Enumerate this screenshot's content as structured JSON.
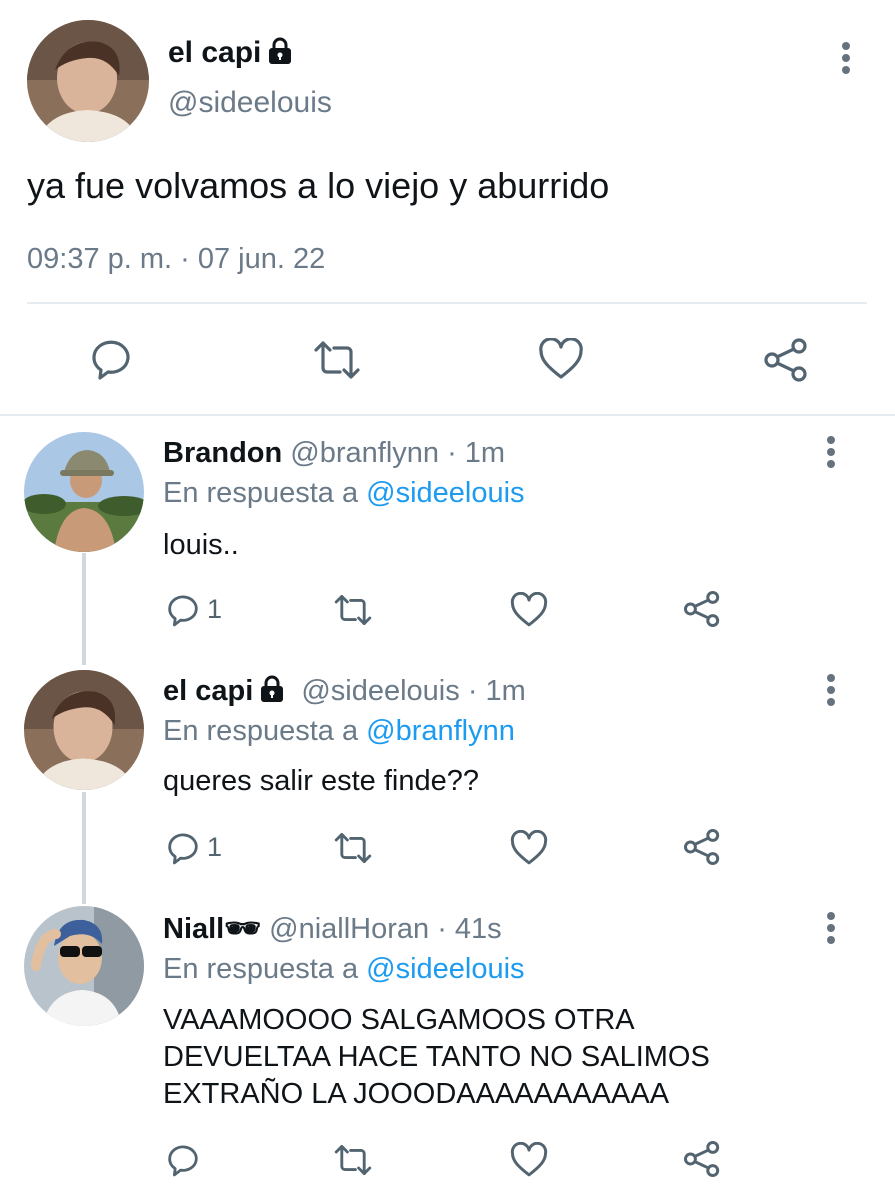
{
  "main_tweet": {
    "display_name": "el capi",
    "handle": "@sideelouis",
    "text": "ya fue volvamos a lo viejo y aburrido",
    "timestamp": "09:37 p. m. · 07 jun. 22",
    "icons": [
      "more-vertical-icon",
      "reply-icon",
      "retweet-icon",
      "like-icon",
      "share-icon",
      "lock-icon"
    ]
  },
  "replies": [
    {
      "display_name": "Brandon",
      "handle": "@branflynn",
      "age": "· 1m",
      "reply_prefix": "En respuesta a",
      "reply_to": "@sideelouis",
      "text": "louis..",
      "reply_count": "1"
    },
    {
      "display_name": "el capi",
      "handle": "@sideelouis",
      "age": "· 1m",
      "reply_prefix": "En respuesta a",
      "reply_to": "@branflynn",
      "text": "queres salir este finde??",
      "reply_count": "1"
    },
    {
      "display_name": "Niall🕶",
      "handle": "@niallHoran",
      "age": "· 41s",
      "reply_prefix": "En respuesta a",
      "reply_to": "@sideelouis",
      "text_lines": [
        "VAAAMOOOO SALGAMOOS OTRA",
        "DEVUELTAA HACE TANTO NO SALIMOS",
        "EXTRAÑO LA JOOODAAAAAAAAAAA"
      ],
      "reply_count": ""
    }
  ],
  "colors": {
    "accent": "#1d9bf0",
    "muted": "#6b7a88",
    "icon": "#536471",
    "divider": "#e6ecf0"
  }
}
